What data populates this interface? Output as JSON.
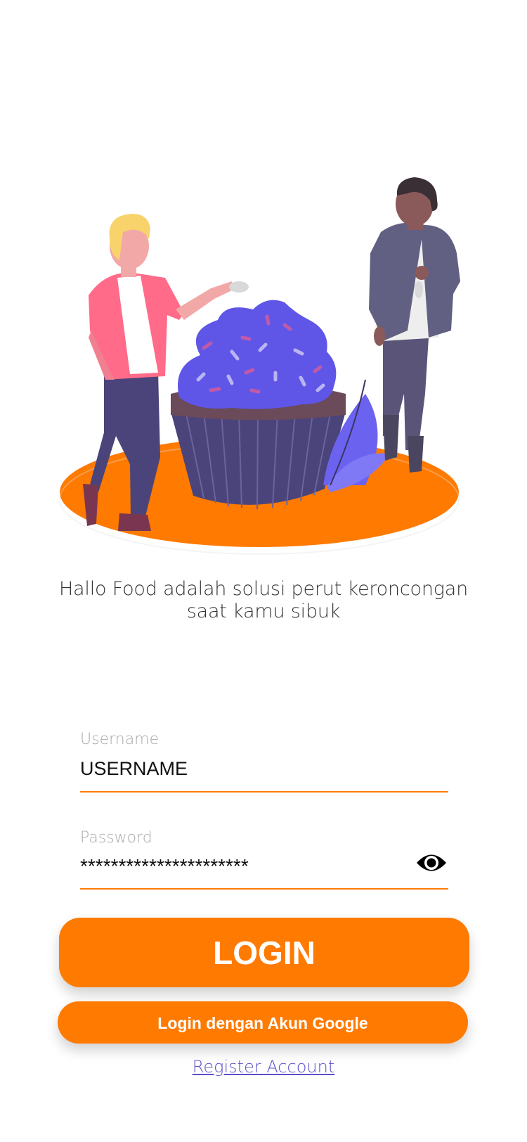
{
  "tagline": "Hallo Food adalah solusi perut keroncongan saat kamu sibuk",
  "login_form": {
    "username": {
      "label": "Username",
      "value": "USERNAME"
    },
    "password": {
      "label": "Password",
      "value": "**********************",
      "toggle_icon": "eye-icon"
    }
  },
  "buttons": {
    "login": "LOGIN",
    "google": "Login dengan Akun Google"
  },
  "register_link": "Register Account",
  "colors": {
    "accent": "#ff7a00",
    "link": "#5b50c8",
    "frosting": "#5f56e8",
    "cupcake_case": "#4a447a"
  }
}
